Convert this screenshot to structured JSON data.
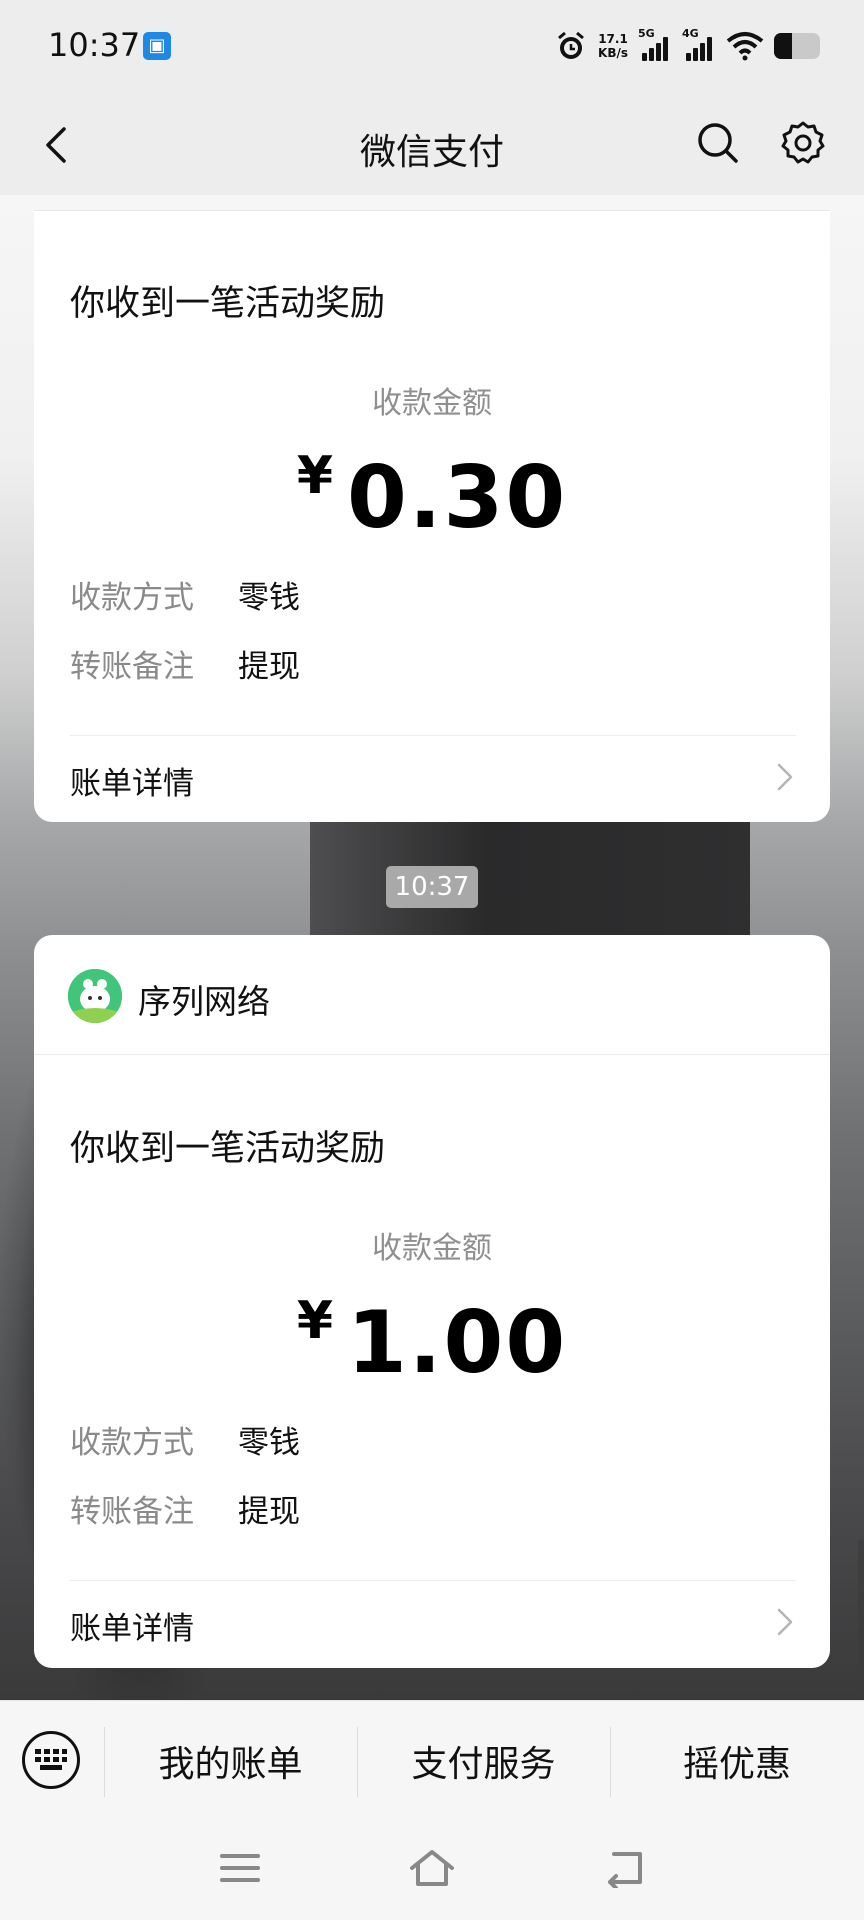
{
  "status_bar": {
    "time": "10:37",
    "net_speed_value": "17.1",
    "net_speed_unit": "KB/s",
    "signal1_label": "5G",
    "signal2_label": "4G",
    "icons": [
      "app-notification-icon",
      "alarm-icon",
      "signal-5g-icon",
      "signal-4g-icon",
      "wifi-icon",
      "battery-icon"
    ],
    "battery_level": 0.4
  },
  "nav": {
    "title": "微信支付",
    "icons": [
      "back-icon",
      "search-icon",
      "gear-icon"
    ]
  },
  "messages": [
    {
      "title": "你收到一笔活动奖励",
      "amount_label": "收款金额",
      "currency": "¥",
      "amount": "0.30",
      "method_key": "收款方式",
      "method_value": "零钱",
      "note_key": "转账备注",
      "note_value": "提现",
      "detail_label": "账单详情"
    },
    {
      "merchant": "序列网络",
      "title": "你收到一笔活动奖励",
      "amount_label": "收款金额",
      "currency": "¥",
      "amount": "1.00",
      "method_key": "收款方式",
      "method_value": "零钱",
      "note_key": "转账备注",
      "note_value": "提现",
      "detail_label": "账单详情"
    }
  ],
  "time_chip": "10:37",
  "bottom_menu": {
    "items": [
      "我的账单",
      "支付服务",
      "摇优惠"
    ],
    "icons": [
      "keyboard-icon"
    ]
  },
  "system_nav": {
    "icons": [
      "menu-icon",
      "home-icon",
      "back-gesture-icon"
    ]
  },
  "colors": {
    "accent_green": "#41c57a",
    "status_app_blue": "#1e88e5",
    "secondary_text": "#8a8a8a"
  }
}
